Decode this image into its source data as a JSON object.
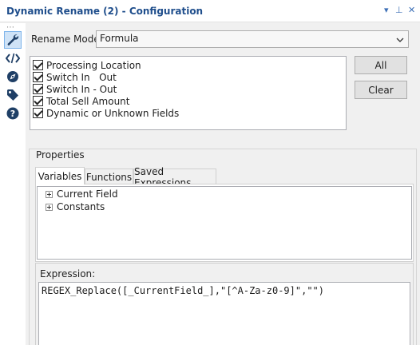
{
  "window": {
    "title": "Dynamic Rename (2) - Configuration",
    "controls": {
      "menu": "▾",
      "pin": "⊥",
      "close": "✕"
    }
  },
  "sidebar": {
    "grip": "⋯",
    "items": [
      {
        "name": "configuration",
        "icon": "wrench-icon",
        "active": true
      },
      {
        "name": "annotation",
        "icon": "code-icon",
        "active": false
      },
      {
        "name": "navigation",
        "icon": "compass-icon",
        "active": false
      },
      {
        "name": "tags",
        "icon": "tag-icon",
        "active": false
      },
      {
        "name": "help",
        "icon": "help-icon",
        "active": false
      }
    ]
  },
  "rename_mode": {
    "label": "Rename Mode:",
    "value": "Formula"
  },
  "fields": [
    {
      "label": "Processing Location",
      "checked": true
    },
    {
      "label": "Switch In   Out",
      "checked": true
    },
    {
      "label": "Switch In - Out",
      "checked": true
    },
    {
      "label": "Total Sell Amount",
      "checked": true
    },
    {
      "label": "Dynamic or Unknown Fields",
      "checked": true
    }
  ],
  "buttons": {
    "all": "All",
    "clear": "Clear"
  },
  "properties": {
    "label": "Properties",
    "tabs": [
      "Variables",
      "Functions",
      "Saved Expressions"
    ],
    "selected_tab": "Variables",
    "tree": [
      "Current Field",
      "Constants"
    ]
  },
  "expression": {
    "label": "Expression:",
    "value": "REGEX_Replace([_CurrentField_],\"[^A-Za-z0-9]\",\"\")"
  }
}
